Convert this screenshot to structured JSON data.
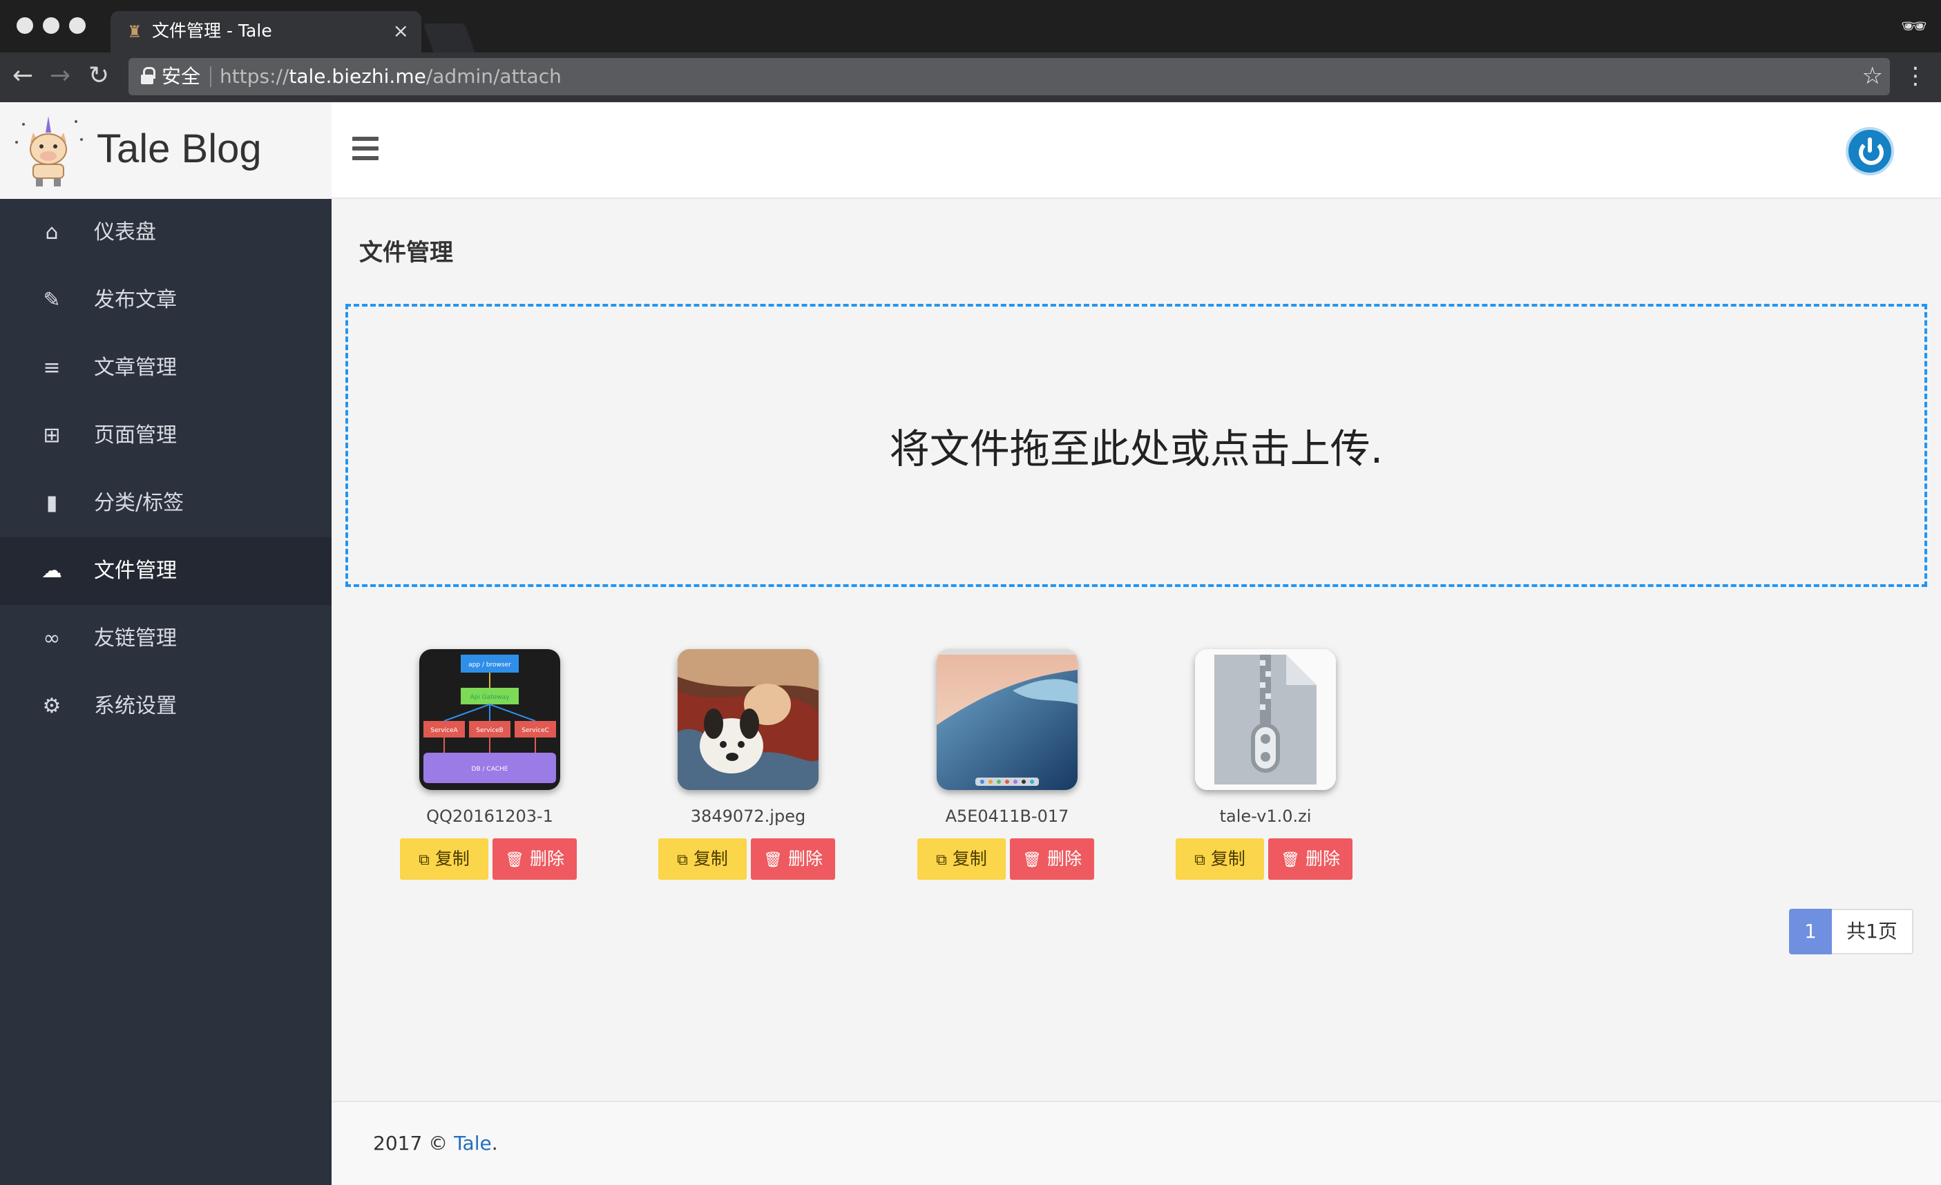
{
  "browser": {
    "tab_title": "文件管理 - Tale",
    "tab_close": "×",
    "secure_label": "安全",
    "url_scheme": "https://",
    "url_host": "tale.biezhi.me",
    "url_path": "/admin/attach",
    "back": "←",
    "forward": "→",
    "reload": "↻",
    "star": "☆",
    "menu": "⋮",
    "incognito": "🕶"
  },
  "brand": {
    "name": "Tale Blog"
  },
  "sidebar": {
    "items": [
      {
        "label": "仪表盘",
        "icon": "home-icon",
        "glyph": "⌂",
        "active": false
      },
      {
        "label": "发布文章",
        "icon": "pencil-icon",
        "glyph": "✎",
        "active": false
      },
      {
        "label": "文章管理",
        "icon": "list-icon",
        "glyph": "≡",
        "active": false
      },
      {
        "label": "页面管理",
        "icon": "expand-icon",
        "glyph": "⊞",
        "active": false
      },
      {
        "label": "分类/标签",
        "icon": "book-icon",
        "glyph": "▮",
        "active": false
      },
      {
        "label": "文件管理",
        "icon": "cloud-upload-icon",
        "glyph": "☁",
        "active": true
      },
      {
        "label": "友链管理",
        "icon": "link-icon",
        "glyph": "∞",
        "active": false
      },
      {
        "label": "系统设置",
        "icon": "gear-icon",
        "glyph": "⚙",
        "active": false
      }
    ]
  },
  "main": {
    "title": "文件管理",
    "dropzone_text": "将文件拖至此处或点击上传.",
    "files": [
      {
        "name": "QQ20161203-1",
        "type": "diagram"
      },
      {
        "name": "3849072.jpeg",
        "type": "photo"
      },
      {
        "name": "A5E0411B-017",
        "type": "wave"
      },
      {
        "name": "tale-v1.0.zi",
        "type": "zip"
      }
    ],
    "copy_label": "复制",
    "delete_label": "删除",
    "diagram_labels": {
      "top": "app / browser",
      "gateway": "Api Gateway",
      "a": "ServiceA",
      "b": "ServiceB",
      "c": "ServiceC",
      "db": "DB / CACHE"
    },
    "pagination": {
      "current": "1",
      "total": "共1页"
    }
  },
  "footer": {
    "prefix": "2017 © ",
    "link": "Tale",
    "suffix": "."
  },
  "colors": {
    "accent_blue": "#2196f3",
    "copy_button": "#fbd54a",
    "delete_button": "#ee5a5f",
    "sidebar_bg": "#2b313d",
    "page_active": "#6f8fe0"
  }
}
